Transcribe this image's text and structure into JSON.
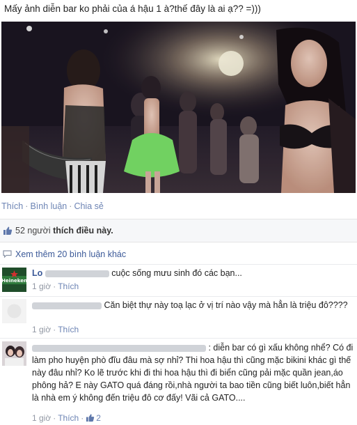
{
  "post": {
    "text": "Mấy ảnh diễn bar ko phải của á hậu 1 à?thế đây là ai ạ?? =)))"
  },
  "actions": {
    "like": "Thích",
    "comment": "Bình luận",
    "share": "Chia sẻ",
    "separator": "·"
  },
  "likes": {
    "count": "52 người",
    "suffix": "thích điều này."
  },
  "more_comments": "Xem thêm 20 bình luận khác",
  "comments": [
    {
      "name": "Lo",
      "text": "cuộc sống mưu sinh đó các bạn...",
      "time": "1 giờ",
      "like": "Thích"
    },
    {
      "name": "",
      "text": "Căn biệt thự này toạ lạc ở vị trí nào vậy mà hẳn là triệu đô????",
      "time": "1 giờ",
      "like": "Thích"
    },
    {
      "name": "",
      "text_line1": ": diễn bar có gì xấu",
      "text_rest": "không nhể? Có đi làm pho huyện phò đĩu đâu mà sợ nhỉ? Thi hoa hậu thì cũng mặc bikini khác gì thế này đâu nhỉ? Ko lẽ trước khi đi thi hoa hậu thì đi biển cũng pải mặc quần jean,áo phông hả? E này GATO quá đáng rồi,nhà người ta bao tiền cũng biết luôn,biết hẳn là nhà em ý không đến triệu đô cơ đấy! Vãi cả GATO....",
      "time": "1 giờ",
      "like": "Thích",
      "like_count": "2"
    }
  ],
  "colors": {
    "link": "#3b5998",
    "action": "#6d84b4",
    "meta": "#9197a3"
  }
}
